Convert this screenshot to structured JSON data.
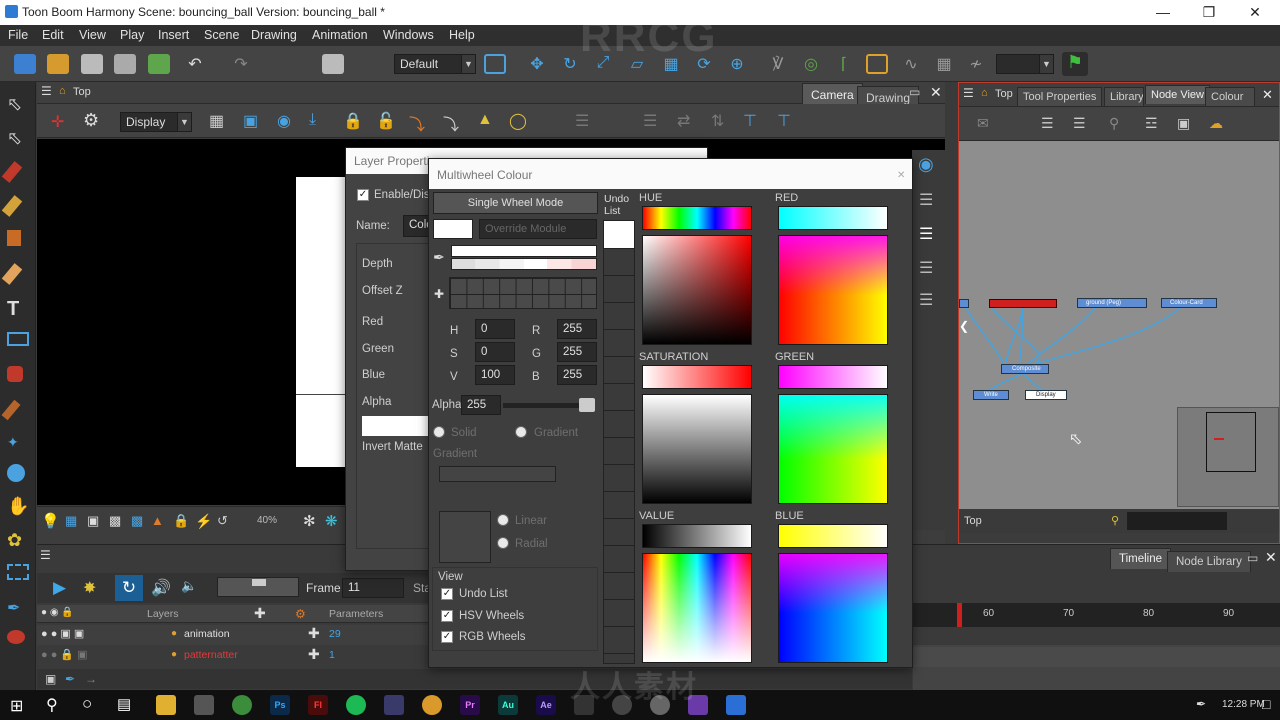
{
  "window": {
    "title": "Toon Boom Harmony Scene: bouncing_ball Version: bouncing_ball *"
  },
  "menu": [
    "File",
    "Edit",
    "View",
    "Play",
    "Insert",
    "Scene",
    "Drawing",
    "Animation",
    "Windows",
    "Help"
  ],
  "toolbar": {
    "workspace": "Default"
  },
  "camera_view": {
    "breadcrumb": "Top",
    "tabs": [
      "Camera",
      "Drawing"
    ],
    "display_select": "Display",
    "zoom": "40%"
  },
  "node_view": {
    "breadcrumb": "Top",
    "tabs": [
      "Tool Properties",
      "Library",
      "Node View",
      "Colour"
    ],
    "footer_label": "Top",
    "nodes": [
      "Composite",
      "Write",
      "Display",
      "ground (Peg)",
      "Colour-Card"
    ]
  },
  "timeline": {
    "tabs": [
      "Timeline",
      "Node Library"
    ],
    "frame_label": "Frame",
    "frame_value": "11",
    "start_label": "Sta",
    "layers_header": "Layers",
    "parameters_header": "Parameters",
    "layers": [
      {
        "name": "animation",
        "param": "29"
      },
      {
        "name": "patternatter",
        "param": "1"
      }
    ],
    "ruler": [
      "60",
      "70",
      "80",
      "90"
    ]
  },
  "layer_properties": {
    "title": "Layer Properties",
    "enable_label": "Enable/Disa",
    "name_label": "Name:",
    "name_value": "Colo",
    "fields": [
      "Depth",
      "Offset Z",
      "Red",
      "Green",
      "Blue",
      "Alpha",
      "Invert Matte"
    ]
  },
  "multiwheel": {
    "title": "Multiwheel Colour",
    "single_wheel_btn": "Single Wheel Mode",
    "override_module": "Override Module",
    "undo_list_label": "Undo List",
    "hsv": {
      "H": "0",
      "S": "0",
      "V": "100"
    },
    "rgb": {
      "R": "255",
      "G": "255",
      "B": "255"
    },
    "alpha_label": "Alpha",
    "alpha_value": "255",
    "solid_label": "Solid",
    "gradient_label": "Gradient",
    "gradient_header": "Gradient",
    "linear_label": "Linear",
    "radial_label": "Radial",
    "view_header": "View",
    "view_options": [
      "Undo List",
      "HSV Wheels",
      "RGB Wheels"
    ],
    "wheels": [
      "HUE",
      "RED",
      "SATURATION",
      "GREEN",
      "VALUE",
      "BLUE"
    ]
  },
  "taskbar": {
    "time": "12:28 PM",
    "apps": [
      "Ps",
      "Fl",
      "Pr",
      "Au",
      "Ae"
    ]
  },
  "watermarks": [
    "RRCG",
    "人人素材"
  ]
}
